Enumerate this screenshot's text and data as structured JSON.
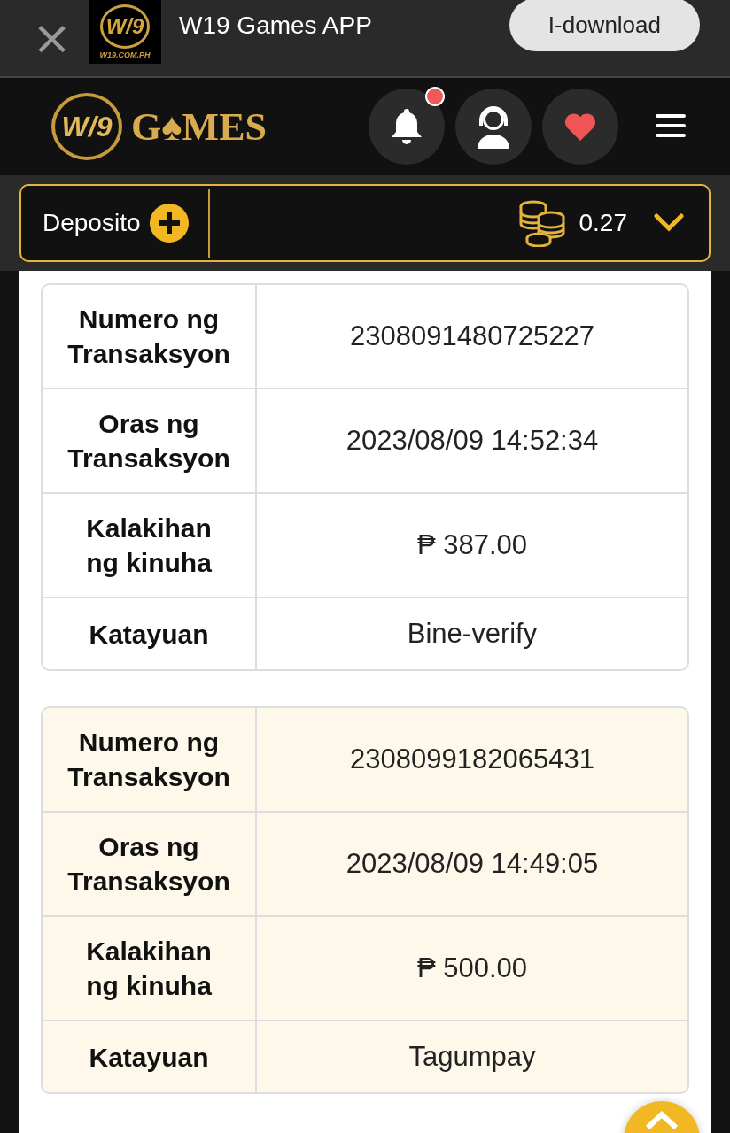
{
  "app_banner": {
    "close": "×",
    "icon_mark": "W/9",
    "icon_caption": "W19.COM.PH",
    "title": "W19 Games APP",
    "button": "I-download"
  },
  "header": {
    "logo_mark": "W/9",
    "logo_word": "G♠MES",
    "has_notification": true
  },
  "wallet": {
    "deposit_label": "Deposito",
    "balance": "0.27"
  },
  "records": [
    {
      "highlighted": false,
      "rows": [
        {
          "label": "Numero ng Transaksyon",
          "value": "2308091480725227"
        },
        {
          "label": "Oras ng Transaksyon",
          "value": "2023/08/09 14:52:34"
        },
        {
          "label": "Kalakihan ng kinuha",
          "value": "₱ 387.00"
        },
        {
          "label": "Katayuan",
          "value": "Bine-verify"
        }
      ]
    },
    {
      "highlighted": true,
      "rows": [
        {
          "label": "Numero ng Transaksyon",
          "value": "2308099182065431"
        },
        {
          "label": "Oras ng Transaksyon",
          "value": "2023/08/09 14:49:05"
        },
        {
          "label": "Kalakihan ng kinuha",
          "value": "₱ 500.00"
        },
        {
          "label": "Katayuan",
          "value": "Tagumpay"
        }
      ]
    }
  ]
}
